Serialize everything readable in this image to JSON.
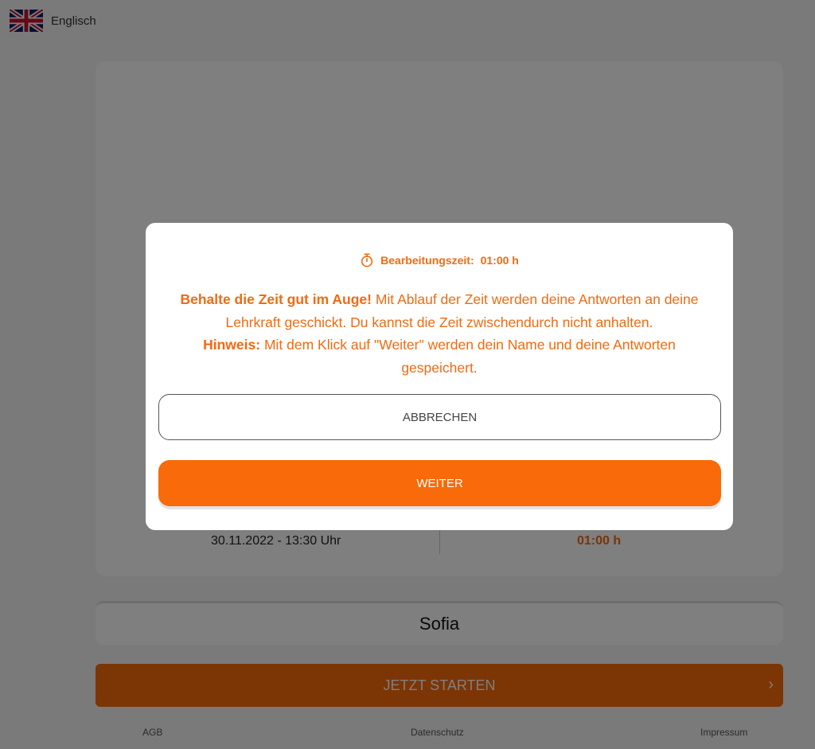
{
  "language": {
    "label": "Englisch",
    "flag_icon": "uk-flag-icon"
  },
  "test_info": {
    "date": "30.11.2022 - 13:30 Uhr",
    "duration": "01:00 h"
  },
  "name_field": {
    "value": "Sofia"
  },
  "start_button": {
    "label": "JETZT STARTEN",
    "icon": "chevron-right-icon"
  },
  "footer": {
    "agb": "AGB",
    "privacy": "Datenschutz",
    "imprint": "Impressum"
  },
  "modal": {
    "timer_icon": "stopwatch-icon",
    "timer_label": "Bearbeitungszeit:",
    "timer_value": "01:00 h",
    "warning_bold": "Behalte die Zeit gut im Auge!",
    "warning_text": "Mit Ablauf der Zeit werden deine Antworten an deine Lehrkraft geschickt. Du kannst die Zeit zwischendurch nicht anhalten.",
    "note_bold": "Hinweis:",
    "note_text": "Mit dem Klick auf \"Weiter\" werden dein Name und deine Antworten gespeichert.",
    "cancel_label": "ABBRECHEN",
    "next_label": "WEITER"
  },
  "colors": {
    "accent": "#f86a0a",
    "text_accent": "#f26a10",
    "overlay": "rgba(0,0,0,0.5)"
  }
}
